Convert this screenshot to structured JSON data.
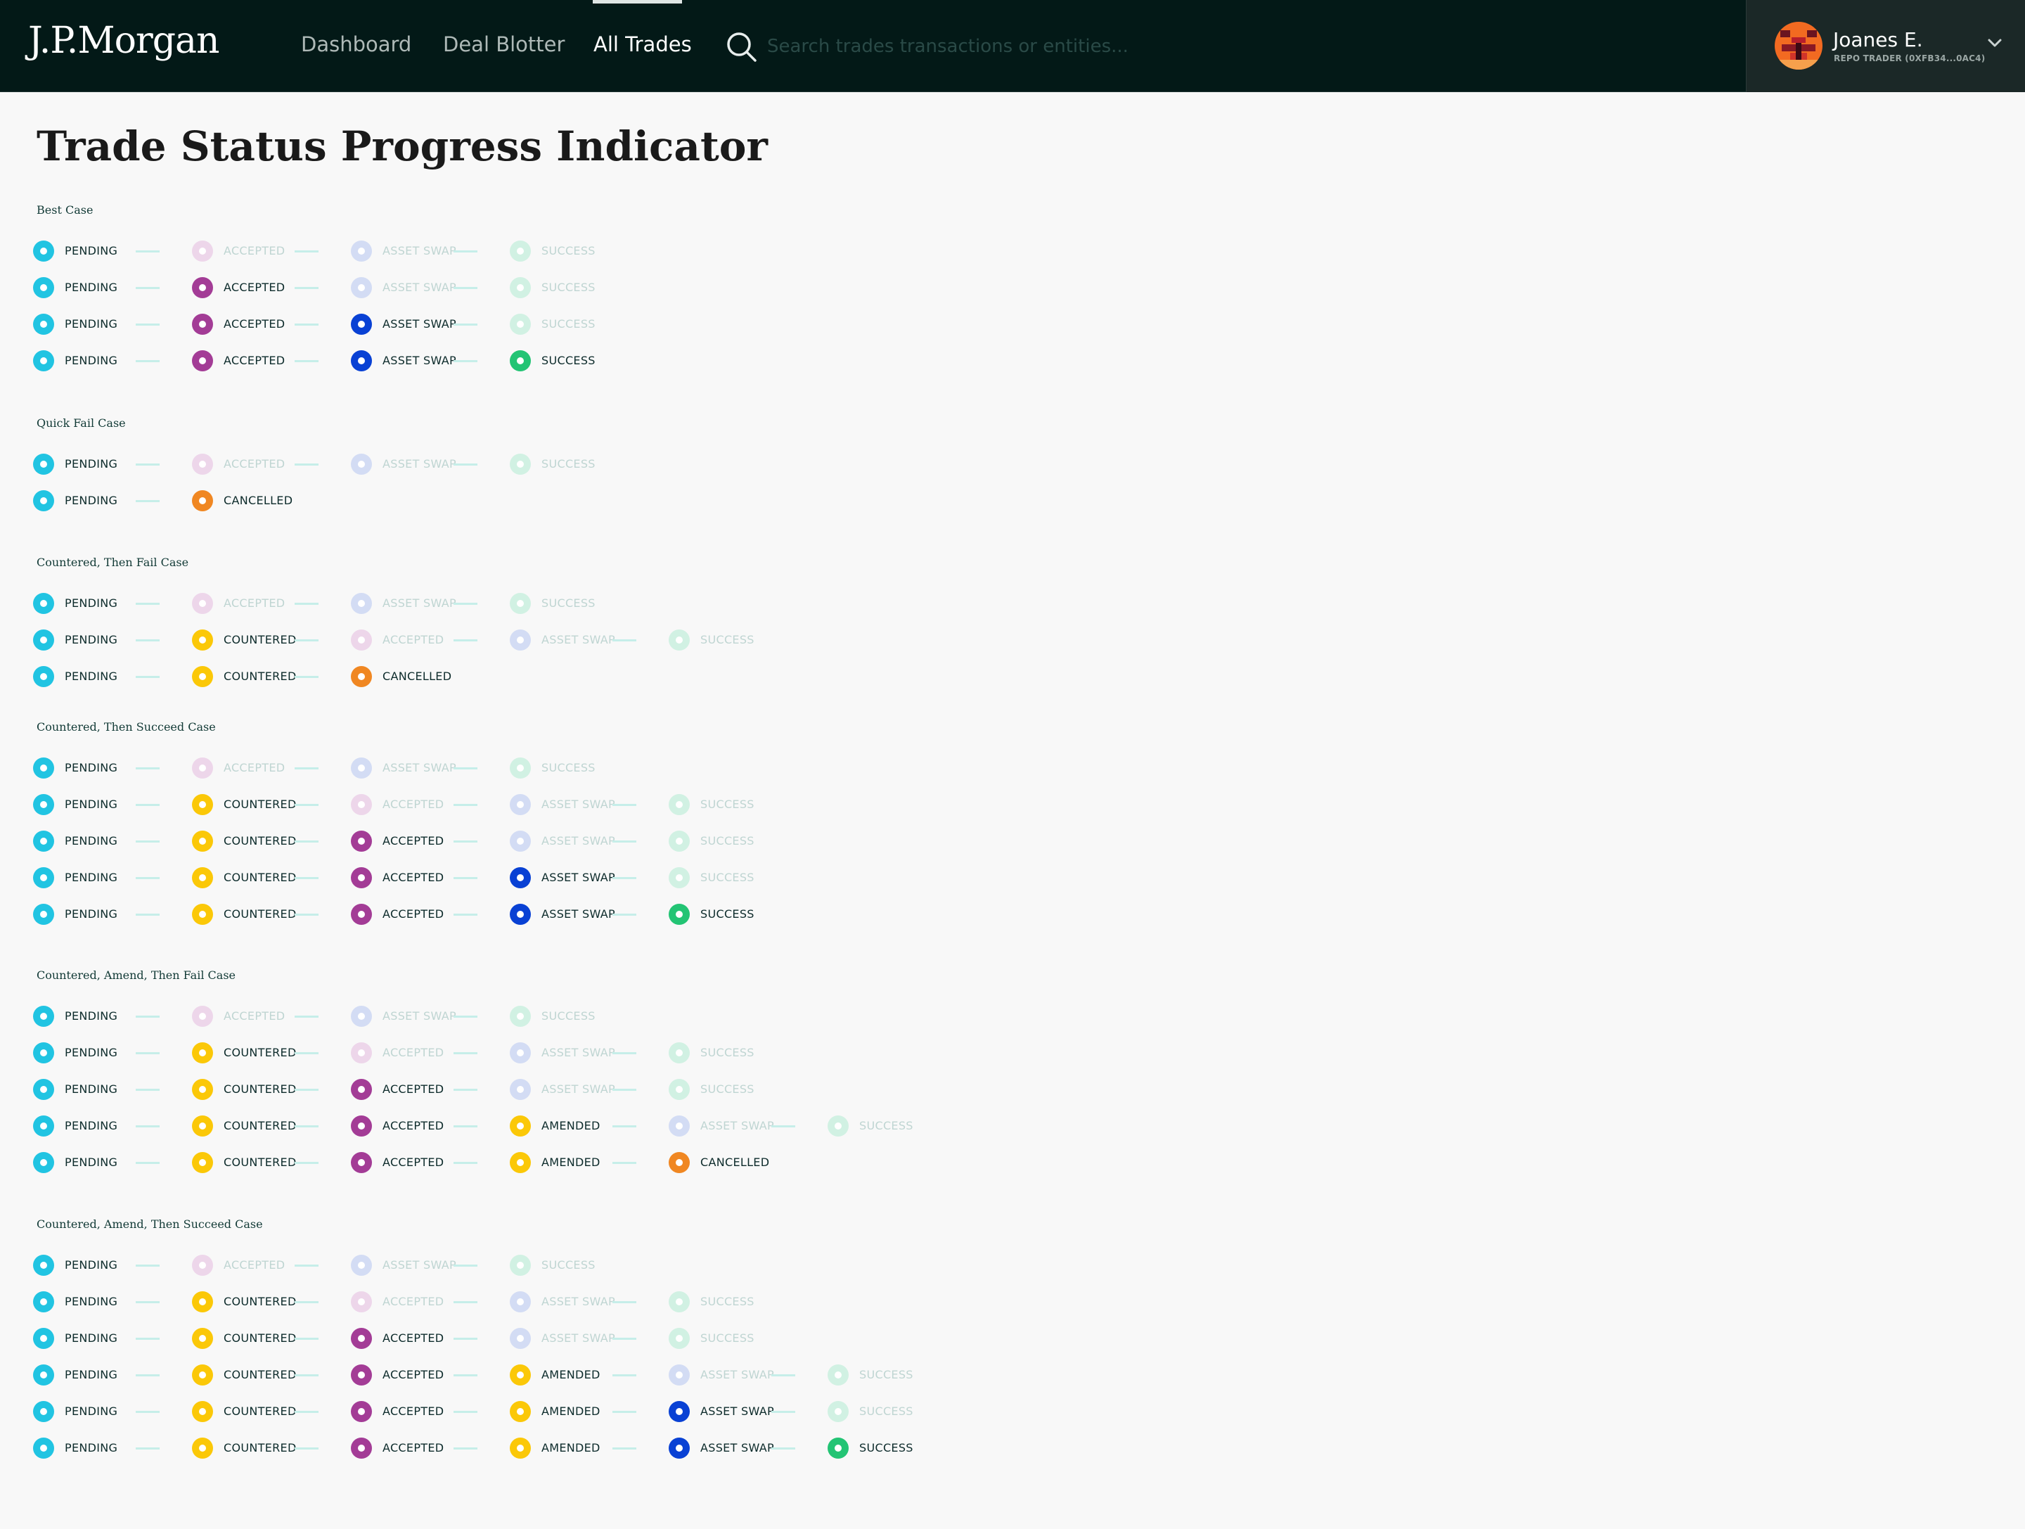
{
  "header": {
    "logo": "J.P.Morgan",
    "nav": [
      {
        "label": "Dashboard"
      },
      {
        "label": "Deal Blotter"
      },
      {
        "label": "All Trades"
      }
    ],
    "active_nav": "All Trades",
    "search": {
      "placeholder": "Search trades transactions or entities...",
      "value": ""
    },
    "user": {
      "name": "Joanes E.",
      "role": "REPO TRADER (0XFB34...0AC4)"
    }
  },
  "page": {
    "title": "Trade Status Progress Indicator"
  },
  "colors": {
    "PENDING": "#21c4e2",
    "ACCEPTED": "#a33c96",
    "ASSET SWAP": "#0941d4",
    "SUCCESS": "#23c474",
    "COUNTERED": "#fbc808",
    "AMENDED": "#fbc808",
    "CANCELLED": "#f08722",
    "faded": {
      "ACCEPTED": "#edd6ea",
      "ASSET SWAP": "#d3dcf4",
      "SUCCESS": "#d1f1e3"
    }
  },
  "sections": [
    {
      "title": "Best Case",
      "rows": [
        [
          [
            "PENDING",
            true
          ],
          [
            "ACCEPTED",
            false
          ],
          [
            "ASSET SWAP",
            false
          ],
          [
            "SUCCESS",
            false
          ]
        ],
        [
          [
            "PENDING",
            true
          ],
          [
            "ACCEPTED",
            true
          ],
          [
            "ASSET SWAP",
            false
          ],
          [
            "SUCCESS",
            false
          ]
        ],
        [
          [
            "PENDING",
            true
          ],
          [
            "ACCEPTED",
            true
          ],
          [
            "ASSET SWAP",
            true
          ],
          [
            "SUCCESS",
            false
          ]
        ],
        [
          [
            "PENDING",
            true
          ],
          [
            "ACCEPTED",
            true
          ],
          [
            "ASSET SWAP",
            true
          ],
          [
            "SUCCESS",
            true
          ]
        ]
      ]
    },
    {
      "title": "Quick Fail Case",
      "rows": [
        [
          [
            "PENDING",
            true
          ],
          [
            "ACCEPTED",
            false
          ],
          [
            "ASSET SWAP",
            false
          ],
          [
            "SUCCESS",
            false
          ]
        ],
        [
          [
            "PENDING",
            true
          ],
          [
            "CANCELLED",
            true
          ]
        ]
      ]
    },
    {
      "title": "Countered, Then Fail Case",
      "rows": [
        [
          [
            "PENDING",
            true
          ],
          [
            "ACCEPTED",
            false
          ],
          [
            "ASSET SWAP",
            false
          ],
          [
            "SUCCESS",
            false
          ]
        ],
        [
          [
            "PENDING",
            true
          ],
          [
            "COUNTERED",
            true
          ],
          [
            "ACCEPTED",
            false
          ],
          [
            "ASSET SWAP",
            false
          ],
          [
            "SUCCESS",
            false
          ]
        ],
        [
          [
            "PENDING",
            true
          ],
          [
            "COUNTERED",
            true
          ],
          [
            "CANCELLED",
            true
          ]
        ]
      ]
    },
    {
      "title": "Countered, Then Succeed Case",
      "rows": [
        [
          [
            "PENDING",
            true
          ],
          [
            "ACCEPTED",
            false
          ],
          [
            "ASSET SWAP",
            false
          ],
          [
            "SUCCESS",
            false
          ]
        ],
        [
          [
            "PENDING",
            true
          ],
          [
            "COUNTERED",
            true
          ],
          [
            "ACCEPTED",
            false
          ],
          [
            "ASSET SWAP",
            false
          ],
          [
            "SUCCESS",
            false
          ]
        ],
        [
          [
            "PENDING",
            true
          ],
          [
            "COUNTERED",
            true
          ],
          [
            "ACCEPTED",
            true
          ],
          [
            "ASSET SWAP",
            false
          ],
          [
            "SUCCESS",
            false
          ]
        ],
        [
          [
            "PENDING",
            true
          ],
          [
            "COUNTERED",
            true
          ],
          [
            "ACCEPTED",
            true
          ],
          [
            "ASSET SWAP",
            true
          ],
          [
            "SUCCESS",
            false
          ]
        ],
        [
          [
            "PENDING",
            true
          ],
          [
            "COUNTERED",
            true
          ],
          [
            "ACCEPTED",
            true
          ],
          [
            "ASSET SWAP",
            true
          ],
          [
            "SUCCESS",
            true
          ]
        ]
      ]
    },
    {
      "title": "Countered, Amend, Then Fail Case",
      "rows": [
        [
          [
            "PENDING",
            true
          ],
          [
            "ACCEPTED",
            false
          ],
          [
            "ASSET SWAP",
            false
          ],
          [
            "SUCCESS",
            false
          ]
        ],
        [
          [
            "PENDING",
            true
          ],
          [
            "COUNTERED",
            true
          ],
          [
            "ACCEPTED",
            false
          ],
          [
            "ASSET SWAP",
            false
          ],
          [
            "SUCCESS",
            false
          ]
        ],
        [
          [
            "PENDING",
            true
          ],
          [
            "COUNTERED",
            true
          ],
          [
            "ACCEPTED",
            true
          ],
          [
            "ASSET SWAP",
            false
          ],
          [
            "SUCCESS",
            false
          ]
        ],
        [
          [
            "PENDING",
            true
          ],
          [
            "COUNTERED",
            true
          ],
          [
            "ACCEPTED",
            true
          ],
          [
            "AMENDED",
            true
          ],
          [
            "ASSET SWAP",
            false
          ],
          [
            "SUCCESS",
            false
          ]
        ],
        [
          [
            "PENDING",
            true
          ],
          [
            "COUNTERED",
            true
          ],
          [
            "ACCEPTED",
            true
          ],
          [
            "AMENDED",
            true
          ],
          [
            "CANCELLED",
            true
          ]
        ]
      ]
    },
    {
      "title": "Countered, Amend, Then Succeed Case",
      "rows": [
        [
          [
            "PENDING",
            true
          ],
          [
            "ACCEPTED",
            false
          ],
          [
            "ASSET SWAP",
            false
          ],
          [
            "SUCCESS",
            false
          ]
        ],
        [
          [
            "PENDING",
            true
          ],
          [
            "COUNTERED",
            true
          ],
          [
            "ACCEPTED",
            false
          ],
          [
            "ASSET SWAP",
            false
          ],
          [
            "SUCCESS",
            false
          ]
        ],
        [
          [
            "PENDING",
            true
          ],
          [
            "COUNTERED",
            true
          ],
          [
            "ACCEPTED",
            true
          ],
          [
            "ASSET SWAP",
            false
          ],
          [
            "SUCCESS",
            false
          ]
        ],
        [
          [
            "PENDING",
            true
          ],
          [
            "COUNTERED",
            true
          ],
          [
            "ACCEPTED",
            true
          ],
          [
            "AMENDED",
            true
          ],
          [
            "ASSET SWAP",
            false
          ],
          [
            "SUCCESS",
            false
          ]
        ],
        [
          [
            "PENDING",
            true
          ],
          [
            "COUNTERED",
            true
          ],
          [
            "ACCEPTED",
            true
          ],
          [
            "AMENDED",
            true
          ],
          [
            "ASSET SWAP",
            true
          ],
          [
            "SUCCESS",
            false
          ]
        ],
        [
          [
            "PENDING",
            true
          ],
          [
            "COUNTERED",
            true
          ],
          [
            "ACCEPTED",
            true
          ],
          [
            "AMENDED",
            true
          ],
          [
            "ASSET SWAP",
            true
          ],
          [
            "SUCCESS",
            true
          ]
        ]
      ]
    }
  ]
}
